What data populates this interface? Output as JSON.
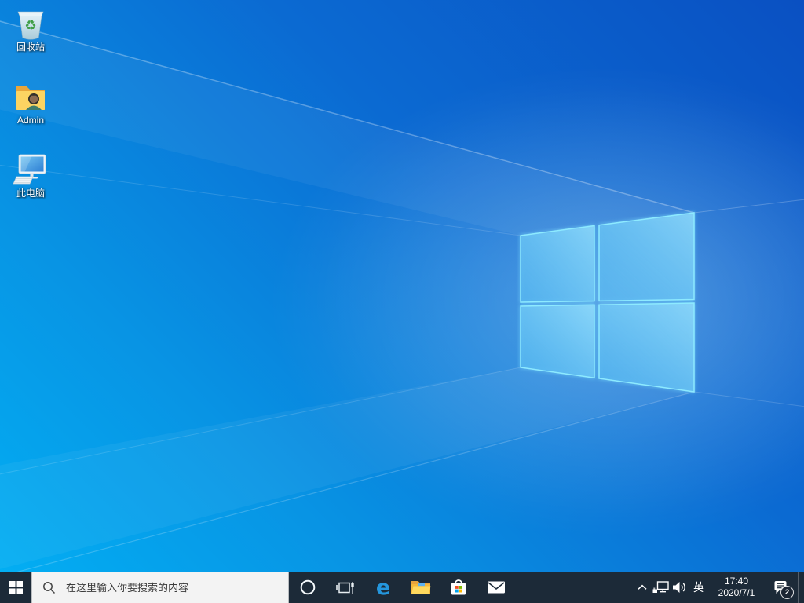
{
  "desktop": {
    "icons": [
      {
        "name": "recycle-bin",
        "label": "回收站",
        "glyph": "♻"
      },
      {
        "name": "admin-folder",
        "label": "Admin"
      },
      {
        "name": "this-pc",
        "label": "此电脑"
      }
    ]
  },
  "taskbar": {
    "search": {
      "placeholder": "在这里输入你要搜索的内容"
    },
    "edge_glyph": "e",
    "buttons": [
      "cortana",
      "task-view",
      "edge",
      "file-explorer",
      "store",
      "mail"
    ],
    "tray": {
      "ime_label": "英",
      "clock": {
        "time": "17:40",
        "date": "2020/7/1"
      },
      "action_center_badge": "2"
    }
  },
  "colors": {
    "taskbar_bg": "#1c2a38",
    "search_bg": "#f3f3f3",
    "wallpaper_top_right": "#0a50c2",
    "wallpaper_bottom_left": "#02b0f4",
    "logo_edge_glow": "#8deaff",
    "store_red": "#f25022",
    "store_green": "#7fba00",
    "store_blue": "#00a4ef",
    "store_yellow": "#ffb900",
    "folder_yellow": "#ffd05e",
    "edge_blue": "#2496dd"
  }
}
